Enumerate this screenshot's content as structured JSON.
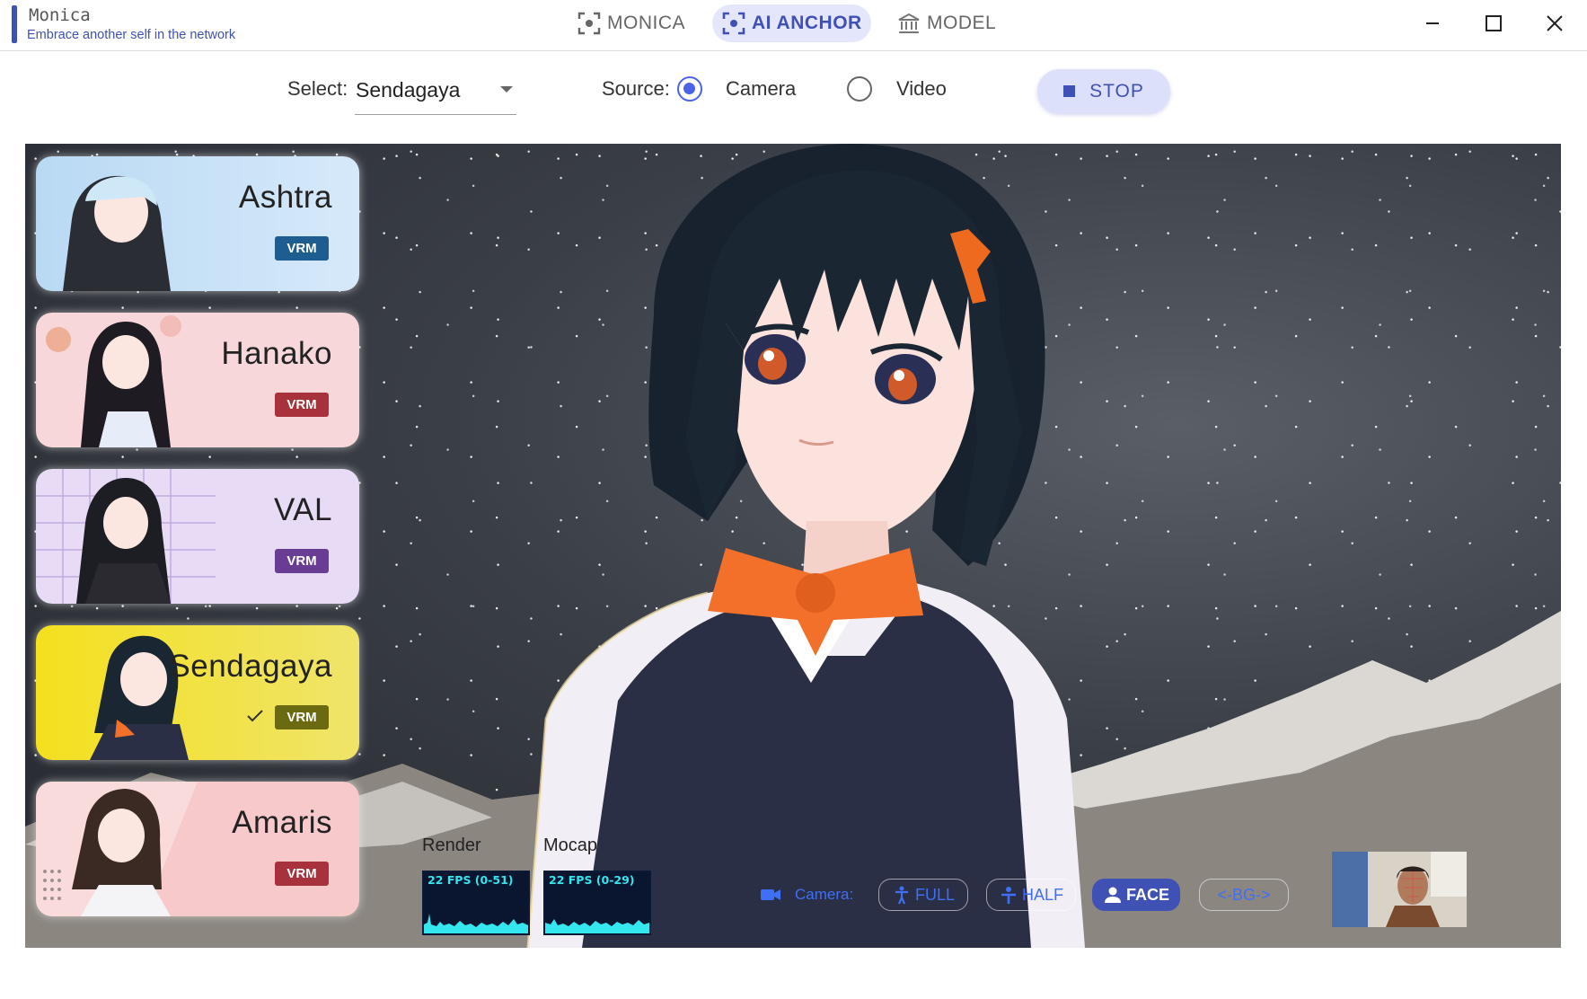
{
  "app": {
    "title": "Monica",
    "subtitle": "Embrace another self in the network",
    "accent_color": "#3f51b5"
  },
  "nav": {
    "items": [
      {
        "label": "MONICA",
        "icon": "focus-frame-icon",
        "active": false
      },
      {
        "label": "AI ANCHOR",
        "icon": "focus-frame-icon",
        "active": true
      },
      {
        "label": "MODEL",
        "icon": "bank-icon",
        "active": false
      }
    ]
  },
  "window_controls": [
    "minimize-icon",
    "maximize-icon",
    "close-icon"
  ],
  "toolbar": {
    "select_label": "Select:",
    "select_value": "Sendagaya",
    "source_label": "Source:",
    "source_options": [
      {
        "label": "Camera",
        "checked": true
      },
      {
        "label": "Video",
        "checked": false
      }
    ],
    "stop_label": "STOP"
  },
  "avatars": [
    {
      "name": "Ashtra",
      "badge": "VRM",
      "bg": "#cfe5f8",
      "badge_color": "#1d5d8f",
      "selected": false
    },
    {
      "name": "Hanako",
      "badge": "VRM",
      "bg": "#f8d7da",
      "badge_color": "#a8323c",
      "selected": false
    },
    {
      "name": "VAL",
      "badge": "VRM",
      "bg": "#e7dbf6",
      "badge_color": "#6a3d95",
      "selected": false
    },
    {
      "name": "Sendagaya",
      "badge": "VRM",
      "bg": "#f1e33c",
      "badge_color": "#6b6a10",
      "selected": true
    },
    {
      "name": "Amaris",
      "badge": "VRM",
      "bg": "#f8c9cb",
      "badge_color": "#a8323c",
      "selected": false
    }
  ],
  "perf": {
    "render": {
      "label": "Render",
      "text": "22 FPS (0-51)"
    },
    "mocap": {
      "label": "Mocap",
      "text": "22 FPS (0-29)"
    }
  },
  "camera": {
    "label": "Camera:",
    "modes": [
      {
        "label": "FULL",
        "icon": "full-body-icon",
        "active": false
      },
      {
        "label": "HALF",
        "icon": "half-body-icon",
        "active": false
      },
      {
        "label": "FACE",
        "icon": "person-icon",
        "active": true
      },
      {
        "label": "<-BG->",
        "icon": "",
        "active": false
      }
    ]
  }
}
